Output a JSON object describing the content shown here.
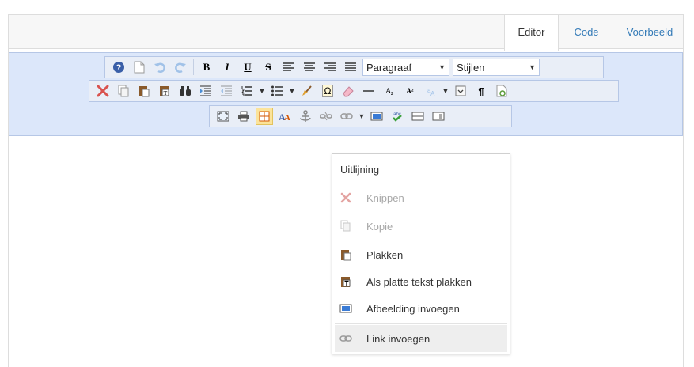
{
  "tabs": [
    {
      "label": "Editor",
      "active": true
    },
    {
      "label": "Code",
      "active": false
    },
    {
      "label": "Voorbeeld",
      "active": false
    }
  ],
  "toolbar": {
    "format_select": "Paragraaf",
    "styles_select": "Stijlen",
    "bold_glyph": "B",
    "italic_glyph": "I",
    "underline_glyph": "U",
    "strike_glyph": "S",
    "subscript_glyph": "A₂",
    "superscript_glyph": "A²",
    "omega_glyph": "Ω",
    "pilcrow_glyph": "¶",
    "abc_glyph": "abc"
  },
  "context_menu": {
    "title": "Uitlijning",
    "items": [
      {
        "label": "Knippen",
        "icon": "scissors-icon",
        "enabled": false
      },
      {
        "label": "Kopie",
        "icon": "copy-icon",
        "enabled": false
      },
      {
        "label": "Plakken",
        "icon": "paste-icon",
        "enabled": true
      },
      {
        "label": "Als platte tekst plakken",
        "icon": "paste-text-icon",
        "enabled": true
      },
      {
        "label": "Afbeelding invoegen",
        "icon": "image-icon",
        "enabled": true
      },
      {
        "label": "Link invoegen",
        "icon": "link-icon",
        "enabled": true,
        "hovered": true
      }
    ]
  },
  "colors": {
    "accent": "#337ab7",
    "toolbar_bg": "#dce7fa",
    "highlight": "#fbe39a"
  }
}
